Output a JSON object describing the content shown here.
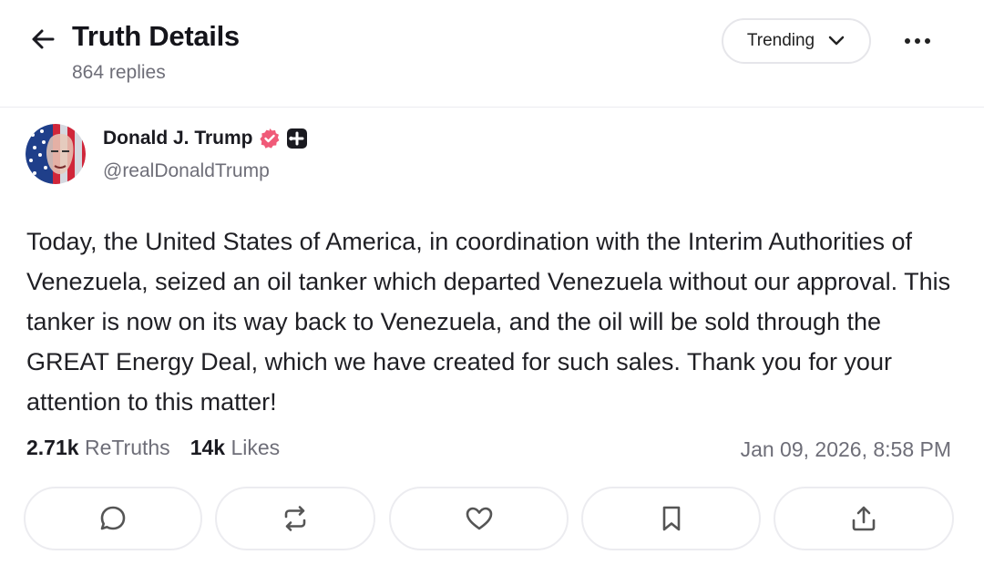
{
  "header": {
    "title": "Truth Details",
    "replies": "864 replies",
    "sort_label": "Trending",
    "back_icon": "arrow-left-icon",
    "more_icon": "more-horizontal-icon"
  },
  "post": {
    "author_name": "Donald J. Trump",
    "handle": "@realDonaldTrump",
    "verified_color": "#f05a78",
    "body": "Today, the United States of America, in coordination with the Interim Authorities of Venezuela, seized an oil tanker which departed Venezuela without our approval. This tanker is now on its way back to Venezuela, and the oil will be sold through the GREAT Energy Deal, which we have created for such sales. Thank you for your attention to this matter!",
    "retruths_count": "2.71k",
    "retruths_label": "ReTruths",
    "likes_count": "14k",
    "likes_label": "Likes",
    "timestamp": "Jan 09, 2026, 8:58 PM"
  },
  "actions": [
    {
      "icon": "reply-icon"
    },
    {
      "icon": "retruth-icon"
    },
    {
      "icon": "heart-icon"
    },
    {
      "icon": "bookmark-icon"
    },
    {
      "icon": "share-icon"
    }
  ],
  "colors": {
    "text": "#1c1c1e",
    "muted": "#6e6e78",
    "border": "#ececf0"
  }
}
